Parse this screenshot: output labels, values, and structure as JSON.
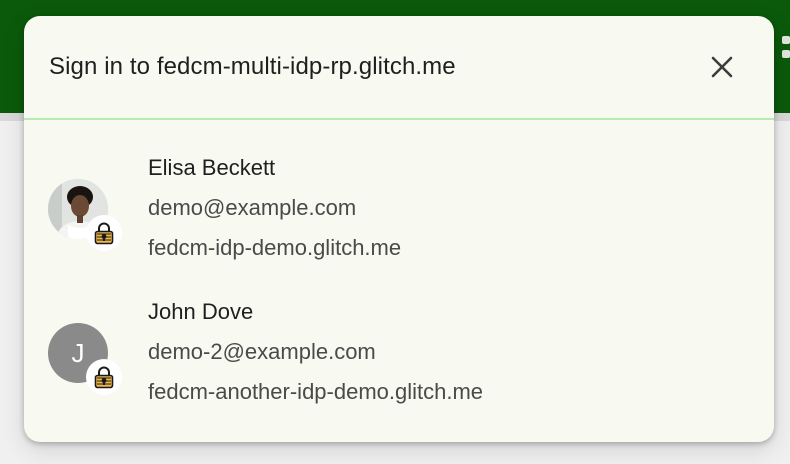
{
  "dialog": {
    "title": "Sign in to fedcm-multi-idp-rp.glitch.me",
    "close_icon": "close-icon"
  },
  "accounts": [
    {
      "name": "Elisa Beckett",
      "email": "demo@example.com",
      "idp": "fedcm-idp-demo.glitch.me",
      "avatar": "profile-photo",
      "badge_icon": "lock-icon"
    },
    {
      "name": "John Dove",
      "email": "demo-2@example.com",
      "idp": "fedcm-another-idp-demo.glitch.me",
      "avatar_letter": "J",
      "badge_icon": "lock-icon"
    }
  ],
  "colors": {
    "page_band": "#0b5a0b",
    "dialog_bg": "#f8f9f1",
    "header_divider": "#b8eab0",
    "letter_avatar": "#8a8a8a"
  }
}
